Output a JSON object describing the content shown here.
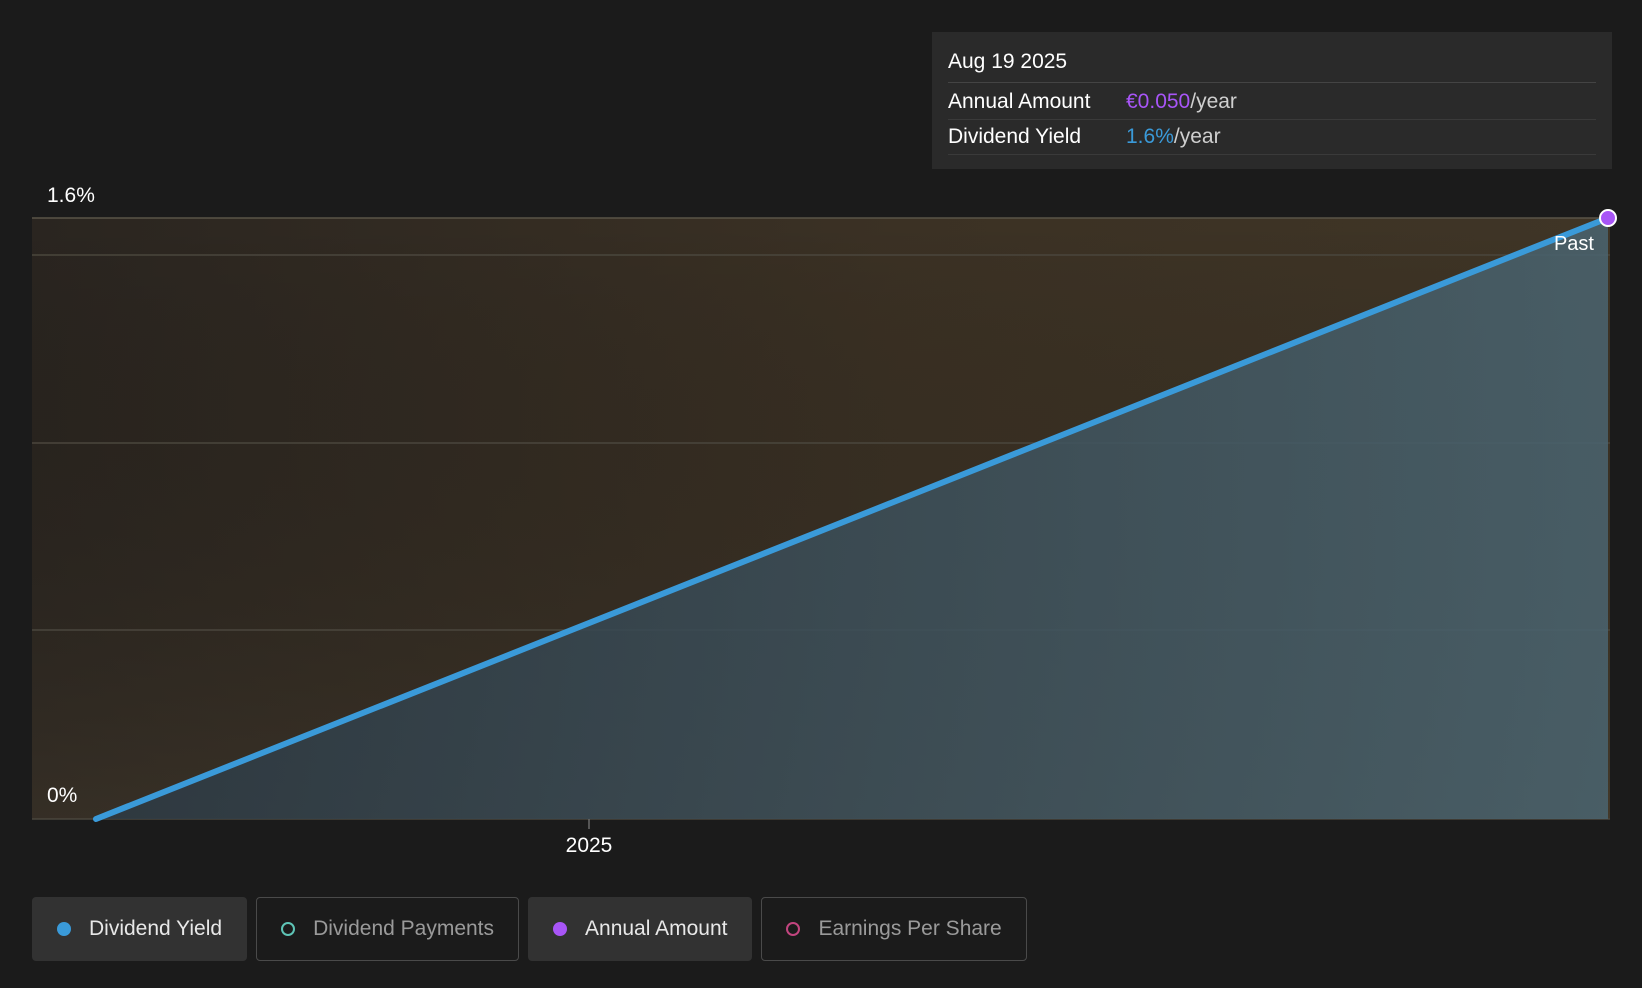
{
  "colors": {
    "background": "#1b1b1b",
    "yield_line": "#3a9ad9",
    "annual_amount": "#a855f7",
    "dividend_payments": "#5ec4b6",
    "earnings_per_share": "#c2457f",
    "past_region": "#3e3222"
  },
  "tooltip": {
    "date": "Aug 19 2025",
    "rows": [
      {
        "label": "Annual Amount",
        "value": "€0.050",
        "unit": "/year",
        "color": "#a855f7"
      },
      {
        "label": "Dividend Yield",
        "value": "1.6%",
        "unit": "/year",
        "color": "#3a9ad9"
      }
    ]
  },
  "chart_data": {
    "type": "area",
    "y_tick_labels": [
      "1.6%",
      "0%"
    ],
    "ylim": [
      0,
      1.6
    ],
    "x_tick_labels": [
      "2025"
    ],
    "region_label": "Past",
    "series": [
      {
        "name": "Dividend Yield",
        "color": "#3a9ad9",
        "x": [
          "2024-11",
          "2025-08-19"
        ],
        "values": [
          0,
          1.6
        ]
      }
    ],
    "marker": {
      "series": "Annual Amount",
      "color": "#a855f7",
      "x": "2025-08-19",
      "value": 1.6
    },
    "grid": true
  },
  "legend": [
    {
      "label": "Dividend Yield",
      "color": "#3a9ad9",
      "active": true,
      "filled": true
    },
    {
      "label": "Dividend Payments",
      "color": "#5ec4b6",
      "active": false,
      "filled": false
    },
    {
      "label": "Annual Amount",
      "color": "#a855f7",
      "active": true,
      "filled": true
    },
    {
      "label": "Earnings Per Share",
      "color": "#c2457f",
      "active": false,
      "filled": false
    }
  ]
}
